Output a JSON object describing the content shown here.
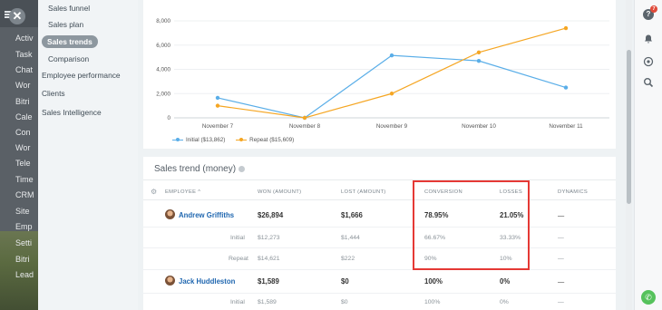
{
  "rail": {
    "items": [
      "Activ",
      "Task",
      "Chat",
      "Wor",
      "Bitri",
      "Cale",
      "Con",
      "Wor",
      "Tele",
      "Time",
      "CRM",
      "Site",
      "Emp",
      "Setti",
      "Bitri",
      "Lead"
    ]
  },
  "submenu": {
    "items": [
      {
        "label": "Sales funnel",
        "active": false
      },
      {
        "label": "Sales plan",
        "active": false
      },
      {
        "label": "Sales trends",
        "active": true
      },
      {
        "label": "Comparison",
        "active": false
      },
      {
        "label": "Employee performance",
        "active": false
      },
      {
        "label": "Clients",
        "active": false
      },
      {
        "label": "Sales Intelligence",
        "active": false
      }
    ]
  },
  "chart_data": {
    "type": "line",
    "categories": [
      "November 7",
      "November 8",
      "November 9",
      "November 10",
      "November 11"
    ],
    "yticks": [
      "8,000",
      "6,000",
      "4,000",
      "2,000",
      "0"
    ],
    "ylim": [
      0,
      8000
    ],
    "series": [
      {
        "name": "Initial ($13,862)",
        "color": "#5aaee8",
        "values": [
          1650,
          0,
          5150,
          4700,
          2500
        ]
      },
      {
        "name": "Repeat ($15,609)",
        "color": "#f5a623",
        "values": [
          1000,
          0,
          2000,
          5400,
          7400
        ]
      }
    ],
    "grid": true,
    "legend": "bottom-left"
  },
  "table": {
    "title": "Sales trend (money)",
    "headers": {
      "employee": "EMPLOYEE",
      "won": "WON (AMOUNT)",
      "lost": "LOST (AMOUNT)",
      "conversion": "CONVERSION",
      "losses": "LOSSES",
      "dynamics": "DYNAMICS"
    },
    "rows": [
      {
        "employee": "Andrew Griffiths",
        "won": "$26,894",
        "lost": "$1,666",
        "conversion": "78.95%",
        "losses": "21.05%",
        "dynamics": "—"
      },
      {
        "employee": "Initial",
        "won": "$12,273",
        "lost": "$1,444",
        "conversion": "66.67%",
        "losses": "33.33%",
        "dynamics": "—"
      },
      {
        "employee": "Repeat",
        "won": "$14,621",
        "lost": "$222",
        "conversion": "90%",
        "losses": "10%",
        "dynamics": "—"
      },
      {
        "employee": "Jack Huddleston",
        "won": "$1,589",
        "lost": "$0",
        "conversion": "100%",
        "losses": "0%",
        "dynamics": "—"
      },
      {
        "employee": "Initial",
        "won": "$1,589",
        "lost": "$0",
        "conversion": "100%",
        "losses": "0%",
        "dynamics": "—"
      }
    ]
  },
  "rightbar": {
    "help_badge": "7"
  }
}
